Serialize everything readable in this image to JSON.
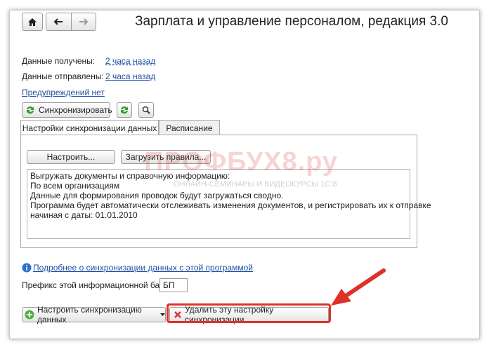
{
  "header": {
    "title": "Зарплата и управление персоналом, редакция 3.0",
    "home_icon": "home-icon",
    "back_icon": "arrow-left-icon",
    "forward_icon": "arrow-right-icon"
  },
  "status": {
    "received_label": "Данные получены:",
    "received_value": "2 часа назад",
    "sent_label": "Данные отправлены:",
    "sent_value": "2 часа назад",
    "warnings_link": "Предупреждений нет"
  },
  "toolbar": {
    "sync_button": "Синхронизировать",
    "sync_icon": "sync-icon",
    "sync_settings_icon": "sync-refresh-icon",
    "search_icon": "search-icon"
  },
  "tabs": [
    {
      "label": "Настройки синхронизации данных",
      "active": true
    },
    {
      "label": "Расписание",
      "active": false
    }
  ],
  "panel": {
    "configure_button": "Настроить...",
    "load_rules_button": "Загрузить правила...",
    "description_lines": [
      "Выгружать документы и справочную информацию:",
      "По всем организациям",
      "Данные для формирования проводок будут загружаться сводно.",
      "Программа будет автоматически отслеживать изменения документов, и регистрировать их к отправке",
      "начиная с даты: 01.01.2010"
    ]
  },
  "watermark": {
    "main": "ПРОФБУХ8.ру",
    "sub": "ОНЛАЙН-СЕМИНАРЫ И ВИДЕОКУРСЫ 1С:8"
  },
  "footer": {
    "info_link": "Подробнее о синхронизации данных с этой программой",
    "info_icon": "info-icon",
    "prefix_label": "Префикс этой информационной базы:",
    "prefix_value": "БП",
    "configure_sync_button": "Настроить синхронизацию данных",
    "delete_sync_button": "Удалить эту настройку синхронизации",
    "add_icon": "add-circle-icon",
    "delete_icon": "delete-x-icon"
  },
  "colors": {
    "link": "#1f4fa3",
    "highlight": "#e0302a",
    "window_border": "#c9c9c9"
  }
}
